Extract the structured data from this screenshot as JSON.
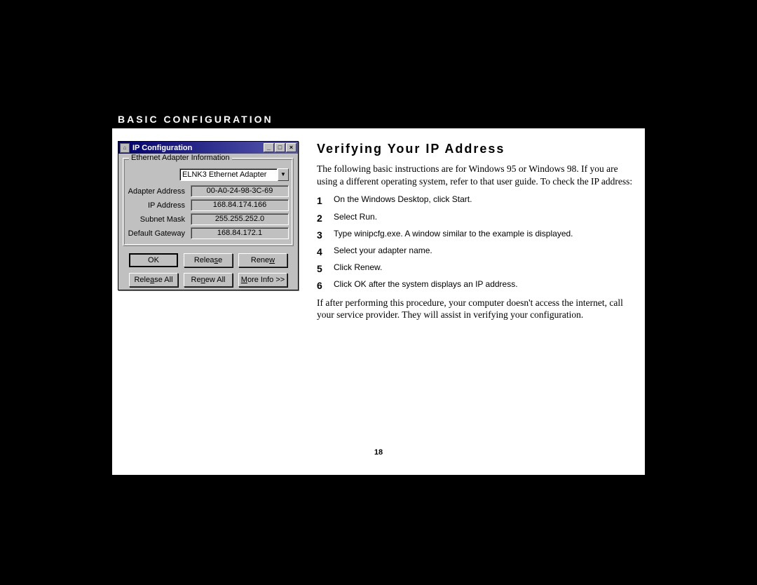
{
  "section_header": "BASIC CONFIGURATION",
  "heading": "Verifying Your IP Address",
  "intro": "The following basic instructions are for Windows 95 or Windows 98. If you are using a different operating system, refer to that user guide. To check the IP address:",
  "steps": [
    {
      "n": "1",
      "text": "On the Windows Desktop, click Start."
    },
    {
      "n": "2",
      "text": "Select Run."
    },
    {
      "n": "3",
      "text": "Type winipcfg.exe. A window similar to the example is displayed."
    },
    {
      "n": "4",
      "text": "Select your adapter name."
    },
    {
      "n": "5",
      "text": "Click Renew."
    },
    {
      "n": "6",
      "text": "Click OK after the system displays an IP address."
    }
  ],
  "outro": "If after performing this procedure, your computer doesn't access the internet, call your service provider. They will assist in verifying your configuration.",
  "page_number": "18",
  "dialog": {
    "title": "IP Configuration",
    "group_legend": "Ethernet Adapter Information",
    "adapter_value": "ELNK3 Ethernet Adapter",
    "fields": [
      {
        "label": "Adapter Address",
        "value": "00-A0-24-98-3C-69"
      },
      {
        "label": "IP Address",
        "value": "168.84.174.166"
      },
      {
        "label": "Subnet Mask",
        "value": "255.255.252.0"
      },
      {
        "label": "Default Gateway",
        "value": "168.84.172.1"
      }
    ],
    "buttons_row1": {
      "ok": "OK",
      "release": "Release",
      "renew": "Renew"
    },
    "buttons_row2": {
      "release_all": "Release All",
      "renew_all": "Renew All",
      "more": "More Info >>"
    }
  }
}
